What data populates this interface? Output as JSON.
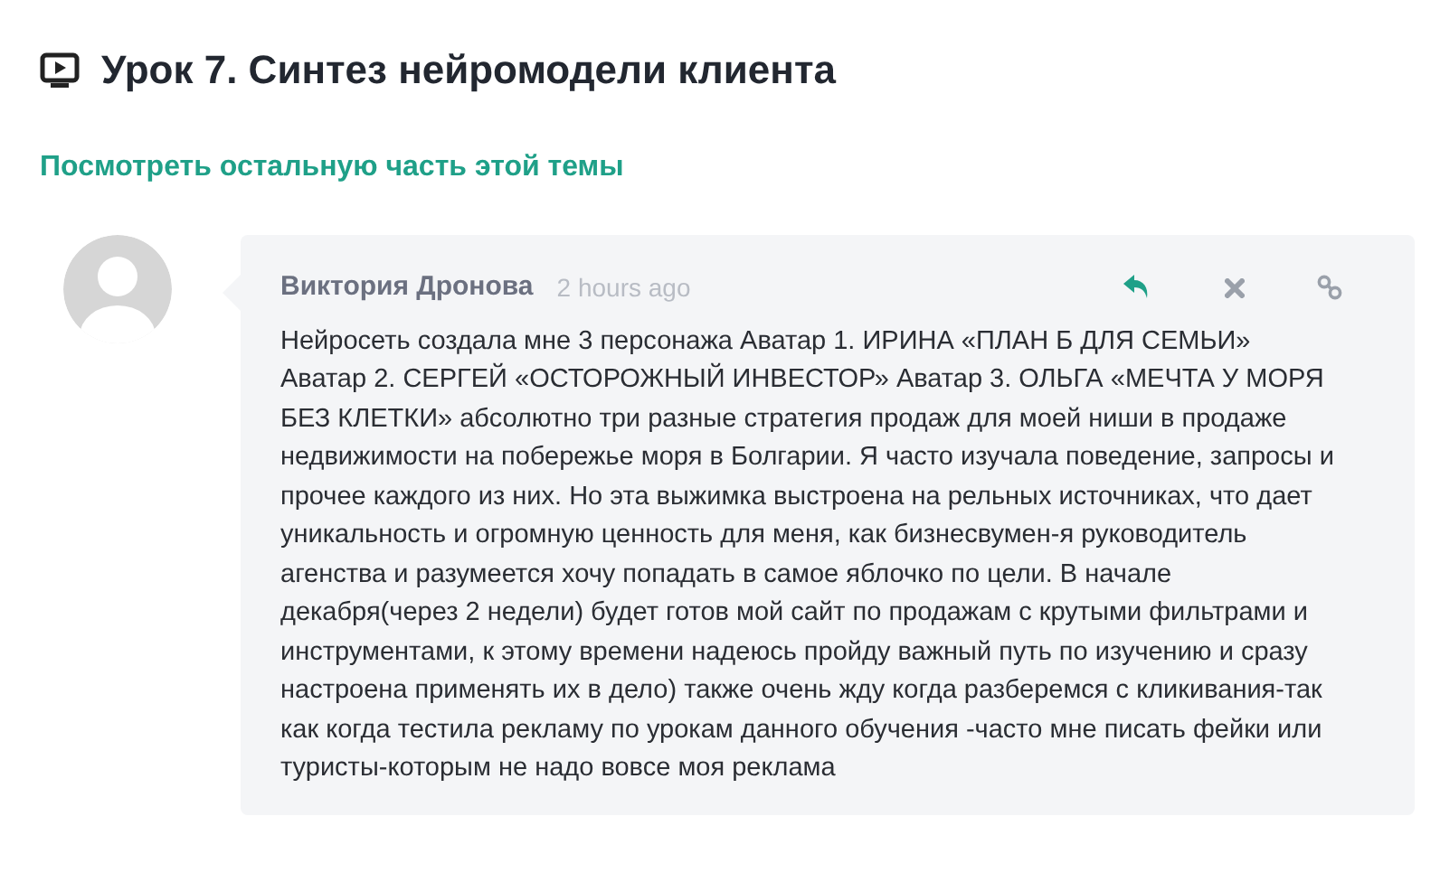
{
  "lesson": {
    "title": "Урок 7. Синтез нейромодели клиента"
  },
  "topic_link": "Посмотреть остальную часть этой темы",
  "comment": {
    "author": "Виктория Дронова",
    "time": "2 hours ago",
    "text": "Нейросеть создала мне 3 персонажа Аватар 1. ИРИНА «ПЛАН Б ДЛЯ СЕМЬИ» Аватар 2. СЕРГЕЙ «ОСТОРОЖНЫЙ ИНВЕСТОР» Аватар 3. ОЛЬГА «МЕЧТА У МОРЯ БЕЗ КЛЕТКИ»  абсолютно три разные стратегия продаж для моей ниши в продаже недвижимости на побережье моря в Болгарии. Я часто изучала поведение, запросы и прочее каждого из них. Но эта выжимка выстроена на рельных источниках, что дает уникальность и огромную ценность для меня, как бизнесвумен-я руководитель агенства и разумеется хочу попадать в самое яблочко по цели. В начале декабря(через 2 недели) будет готов мой сайт по продажам с крутыми фильтрами и инструментами, к этому времени надеюсь пройду важный путь по изучению и сразу настроена применять их в дело) также очень жду когда разберемся с кликивания-так как когда тестила рекламу по урокам данного обучения -часто мне писать фейки или туристы-которым не надо вовсе моя реклама"
  }
}
